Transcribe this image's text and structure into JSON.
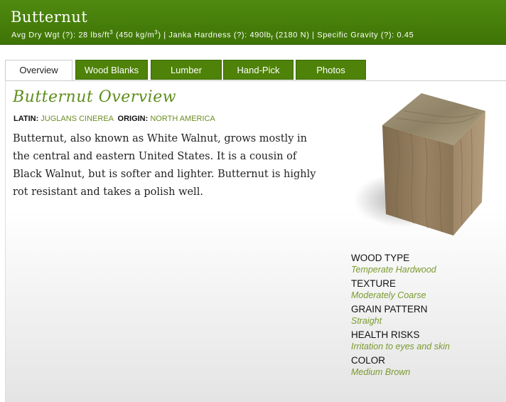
{
  "header": {
    "wood_name": "Butternut",
    "specs": {
      "avg_dry_prefix": "Avg Dry Wgt (?): 28 lbs/ft",
      "avg_dry_exp": "3",
      "avg_dry_metric": " (450 kg/m",
      "metric_exp": "3",
      "janka_prefix": ") | Janka Hardness (?): 490lb",
      "janka_sub": "f",
      "janka_suffix": " (2180 N) | Specific Gravity (?): 0.45"
    }
  },
  "tabs": [
    {
      "label": "Overview",
      "active": true
    },
    {
      "label": "Wood Blanks"
    },
    {
      "label": "Lumber"
    },
    {
      "label": "Hand-Pick"
    },
    {
      "label": "Photos"
    }
  ],
  "overview": {
    "title": "Butternut Overview",
    "latin_label": "LATIN:",
    "latin_value": "JUGLANS CINEREA",
    "origin_label": "ORIGIN:",
    "origin_value": "NORTH AMERICA",
    "description": "Butternut, also known as White Walnut, grows mostly in the central and eastern United States. It is a cousin of Black Walnut, but is softer and lighter. Butternut is highly rot resistant and takes a polish well."
  },
  "properties": [
    {
      "label": "WOOD TYPE",
      "value": "Temperate Hardwood"
    },
    {
      "label": "TEXTURE",
      "value": "Moderately Coarse"
    },
    {
      "label": "GRAIN PATTERN",
      "value": "Straight"
    },
    {
      "label": "HEALTH RISKS",
      "value": "Irritation to eyes and skin"
    },
    {
      "label": "COLOR",
      "value": "Medium Brown"
    }
  ],
  "colors": {
    "header_green": "#4f8a10",
    "tab_green": "#4e8209",
    "accent_green": "#5e8d1a",
    "value_green": "#7a9a30"
  },
  "icons": [
    "wood-cube-image"
  ]
}
